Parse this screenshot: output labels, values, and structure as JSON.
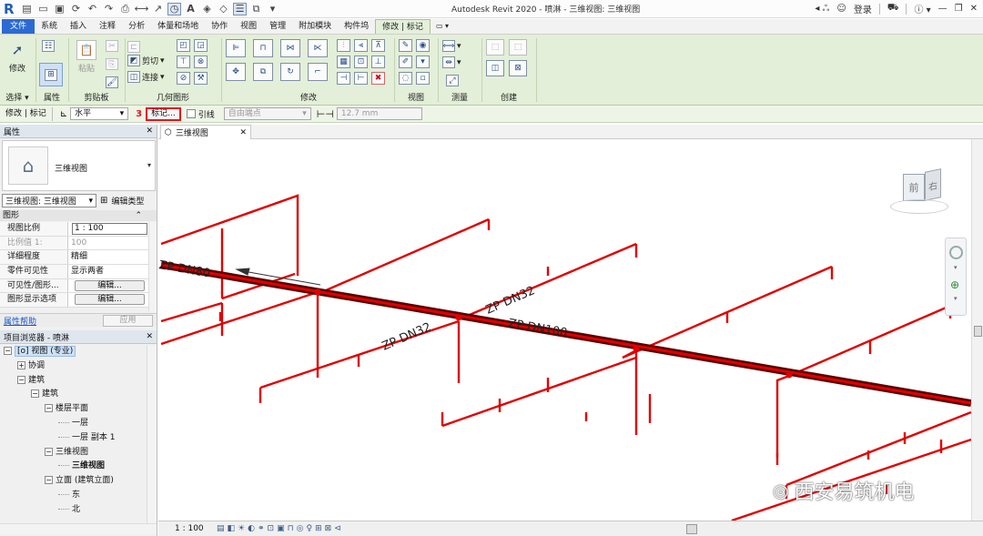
{
  "app": {
    "title": "Autodesk Revit 2020 - 喷淋 - 三维视图: 三维视图",
    "login": "登录",
    "logo": "R"
  },
  "ribbon": {
    "tabs": [
      "文件",
      "系统",
      "插入",
      "注释",
      "分析",
      "体量和场地",
      "协作",
      "视图",
      "管理",
      "附加模块",
      "构件坞",
      "修改 | 标记"
    ],
    "panels": {
      "select": "选择",
      "properties": "属性",
      "clipboard": "剪贴板",
      "geometry": "几何图形",
      "modify": "修改",
      "view": "视图",
      "measure": "测量",
      "create": "创建"
    },
    "buttons": {
      "modify": "修改",
      "paste": "粘贴",
      "cut": "剪切",
      "join": "连接"
    }
  },
  "options_bar": {
    "context": "修改 | 标记",
    "orientation": "水平",
    "tag_button": "标记...",
    "leader_label": "引线",
    "leader_type": "自由端点",
    "leader_length": "12.7 mm"
  },
  "properties": {
    "header": "属性",
    "type_name": "三维视图",
    "instance_selector": "三维视图: 三维视图",
    "edit_type": "编辑类型",
    "group": "图形",
    "rows": [
      {
        "key": "视图比例",
        "value": "1 : 100",
        "kind": "input"
      },
      {
        "key": "比例值 1:",
        "value": "100",
        "kind": "dim"
      },
      {
        "key": "详细程度",
        "value": "精细",
        "kind": "text"
      },
      {
        "key": "零件可见性",
        "value": "显示两者",
        "kind": "text"
      },
      {
        "key": "可见性/图形...",
        "value": "编辑...",
        "kind": "button"
      },
      {
        "key": "图形显示选项",
        "value": "编辑...",
        "kind": "button"
      }
    ],
    "help": "属性帮助",
    "apply": "应用"
  },
  "project_browser": {
    "header": "项目浏览器 - 喷淋",
    "nodes": [
      {
        "label": "[o] 视图 (专业)",
        "depth": 0,
        "toggle": "−",
        "selected": true
      },
      {
        "label": "协调",
        "depth": 1,
        "toggle": "+"
      },
      {
        "label": "建筑",
        "depth": 1,
        "toggle": "−"
      },
      {
        "label": "建筑",
        "depth": 2,
        "toggle": "−"
      },
      {
        "label": "楼层平面",
        "depth": 3,
        "toggle": "−"
      },
      {
        "label": "一层",
        "depth": 4,
        "toggle": ""
      },
      {
        "label": "一层 副本 1",
        "depth": 4,
        "toggle": ""
      },
      {
        "label": "三维视图",
        "depth": 3,
        "toggle": "−"
      },
      {
        "label": "三维视图",
        "depth": 4,
        "toggle": "",
        "bold": true
      },
      {
        "label": "立面 (建筑立面)",
        "depth": 3,
        "toggle": "−"
      },
      {
        "label": "东",
        "depth": 4,
        "toggle": ""
      },
      {
        "label": "北",
        "depth": 4,
        "toggle": ""
      }
    ]
  },
  "view": {
    "tab": "三维视图",
    "scale": "1 : 100",
    "viewcube_front": "前",
    "viewcube_right": "右",
    "tags": {
      "main_pipe": "ZP DN100",
      "main_pipe_left": "ZP DN80",
      "branch_1": "ZP DN32",
      "branch_2": "ZP DN32"
    },
    "watermark": "西安易筑机电"
  },
  "colors": {
    "pipe": "#e00000",
    "pipe_dark": "#5a0000",
    "ribbon": "#e3efd8",
    "file_tab": "#2b6bd1"
  }
}
